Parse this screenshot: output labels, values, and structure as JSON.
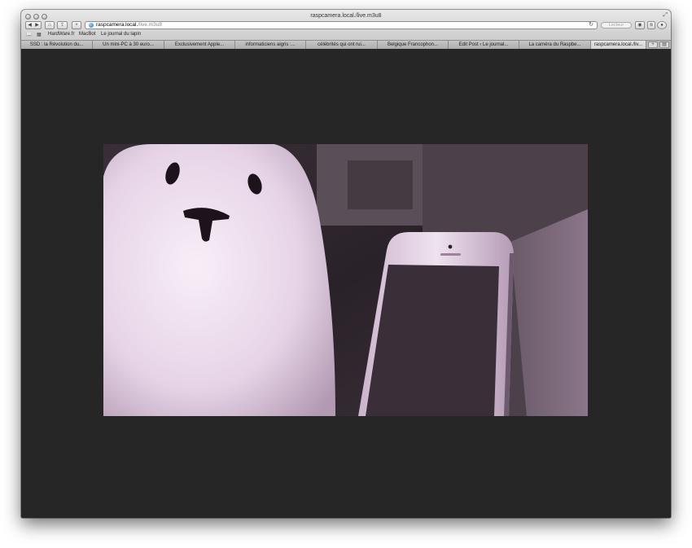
{
  "window": {
    "title": "raspcamera.local./live.m3u8"
  },
  "toolbar": {
    "address_host": "raspcamera.local.",
    "address_path": "/live.m3u8",
    "reader_label": "Lecteur",
    "add_label": "+"
  },
  "bookmarks": [
    {
      "label": "HardWare.fr"
    },
    {
      "label": "MacBot"
    },
    {
      "label": "Le journal du lapin"
    }
  ],
  "tabs": [
    {
      "label": "SSD : la Révolution du..."
    },
    {
      "label": "Un mini-PC à 30 euro..."
    },
    {
      "label": "Exclusivement Apple..."
    },
    {
      "label": "informaticiens aigris :..."
    },
    {
      "label": "célébrités qui ont rui..."
    },
    {
      "label": "Belgique Francophon..."
    },
    {
      "label": "Edit Post ‹ Le journal..."
    },
    {
      "label": "La caméra du Raspbe..."
    },
    {
      "label": "raspcamera.local./liv..."
    }
  ],
  "icons": {
    "back": "back-arrow-icon",
    "forward": "forward-arrow-icon",
    "home": "home-icon",
    "share": "share-icon",
    "reload": "reload-icon",
    "globe": "globe-icon"
  },
  "colors": {
    "page_background": "#262626",
    "chrome": "#cfcfcf"
  }
}
